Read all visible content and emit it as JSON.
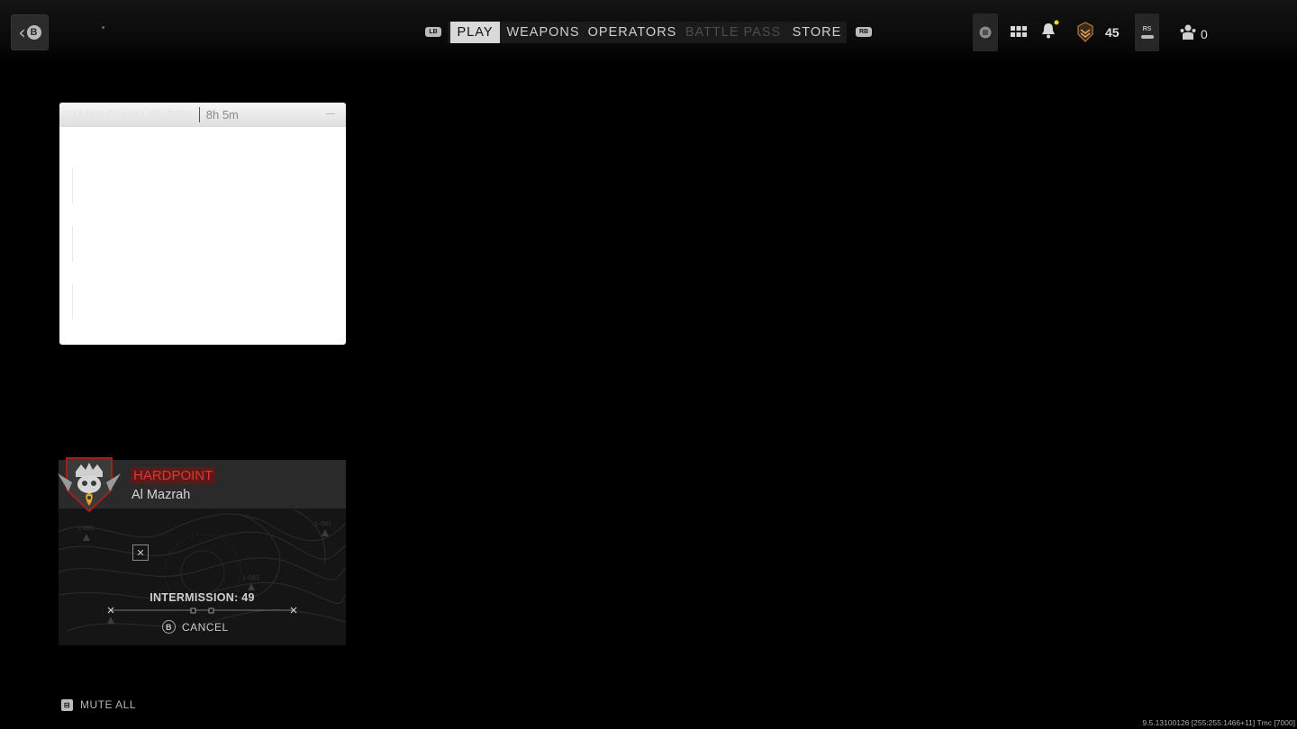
{
  "header": {
    "back_glyph": "B",
    "left_shoulder": "LB",
    "right_shoulder": "RB",
    "tabs": [
      {
        "label": "PLAY",
        "state": "active"
      },
      {
        "label": "WEAPONS",
        "state": "normal"
      },
      {
        "label": "OPERATORS",
        "state": "normal"
      },
      {
        "label": "BATTLE PASS",
        "state": "disabled"
      },
      {
        "label": "STORE",
        "state": "normal"
      }
    ],
    "rank_level": "45",
    "rs_label": "RS",
    "party_count": "0",
    "notification_dot_color": "#f2d22e"
  },
  "daily_challenges": {
    "title": "DAILY CHALLENGES",
    "timer": "8h 5m"
  },
  "match": {
    "mode": "HARDPOINT",
    "map": "Al Mazrah",
    "map_labels": [
      "L-081",
      "L-081",
      "L-081"
    ],
    "intermission": "INTERMISSION: 49",
    "cancel_glyph": "B",
    "cancel_label": "CANCEL"
  },
  "footer": {
    "mute_label": "MUTE ALL",
    "version": "9.5.13100126 [255:255:1466+11] Tmc [7000]"
  }
}
